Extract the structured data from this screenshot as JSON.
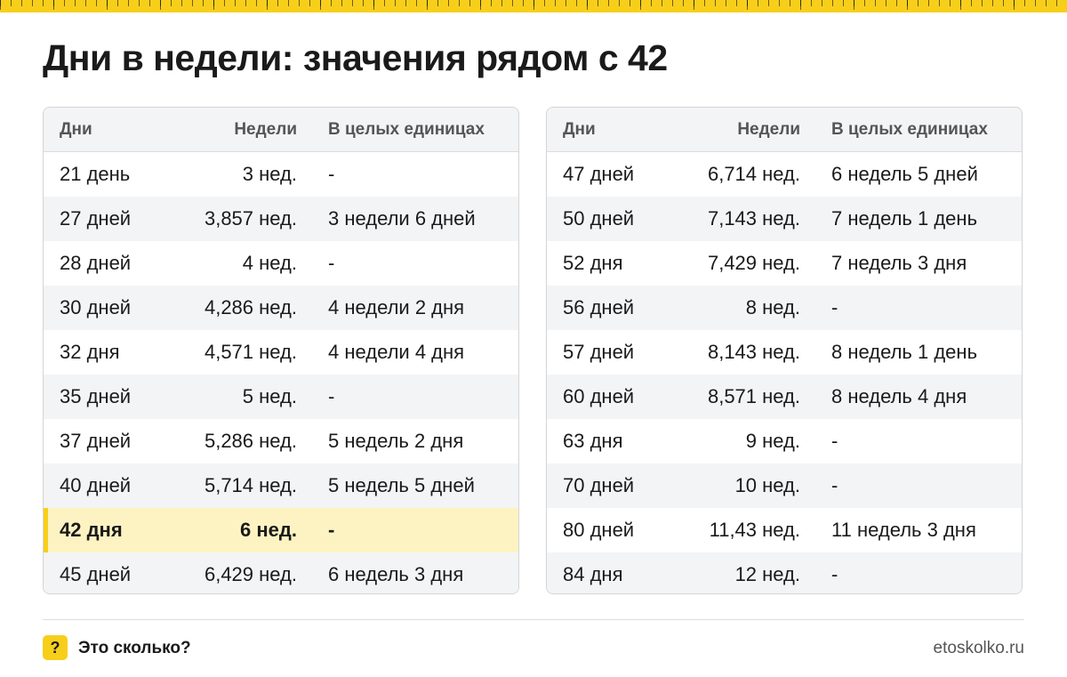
{
  "title": "Дни в недели: значения рядом с 42",
  "columns": {
    "days": "Дни",
    "weeks": "Недели",
    "whole": "В целых единицах"
  },
  "left_table": [
    {
      "days": "21 день",
      "weeks": "3 нед.",
      "whole": "-"
    },
    {
      "days": "27 дней",
      "weeks": "3,857 нед.",
      "whole": "3 недели 6 дней"
    },
    {
      "days": "28 дней",
      "weeks": "4 нед.",
      "whole": "-"
    },
    {
      "days": "30 дней",
      "weeks": "4,286 нед.",
      "whole": "4 недели 2 дня"
    },
    {
      "days": "32 дня",
      "weeks": "4,571 нед.",
      "whole": "4 недели 4 дня"
    },
    {
      "days": "35 дней",
      "weeks": "5 нед.",
      "whole": "-"
    },
    {
      "days": "37 дней",
      "weeks": "5,286 нед.",
      "whole": "5 недель 2 дня"
    },
    {
      "days": "40 дней",
      "weeks": "5,714 нед.",
      "whole": "5 недель 5 дней"
    },
    {
      "days": "42 дня",
      "weeks": "6 нед.",
      "whole": "-",
      "highlighted": true
    },
    {
      "days": "45 дней",
      "weeks": "6,429 нед.",
      "whole": "6 недель 3 дня"
    }
  ],
  "right_table": [
    {
      "days": "47 дней",
      "weeks": "6,714 нед.",
      "whole": "6 недель 5 дней"
    },
    {
      "days": "50 дней",
      "weeks": "7,143 нед.",
      "whole": "7 недель 1 день"
    },
    {
      "days": "52 дня",
      "weeks": "7,429 нед.",
      "whole": "7 недель 3 дня"
    },
    {
      "days": "56 дней",
      "weeks": "8 нед.",
      "whole": "-"
    },
    {
      "days": "57 дней",
      "weeks": "8,143 нед.",
      "whole": "8 недель 1 день"
    },
    {
      "days": "60 дней",
      "weeks": "8,571 нед.",
      "whole": "8 недель 4 дня"
    },
    {
      "days": "63 дня",
      "weeks": "9 нед.",
      "whole": "-"
    },
    {
      "days": "70 дней",
      "weeks": "10 нед.",
      "whole": "-"
    },
    {
      "days": "80 дней",
      "weeks": "11,43 нед.",
      "whole": "11 недель 3 дня"
    },
    {
      "days": "84 дня",
      "weeks": "12 нед.",
      "whole": "-"
    }
  ],
  "footer": {
    "badge_glyph": "?",
    "brand": "Это сколько?",
    "site": "etoskolko.ru"
  },
  "colors": {
    "accent": "#f7cf1b",
    "highlight_row": "#fdf3c2",
    "stripe": "#f3f4f6"
  }
}
